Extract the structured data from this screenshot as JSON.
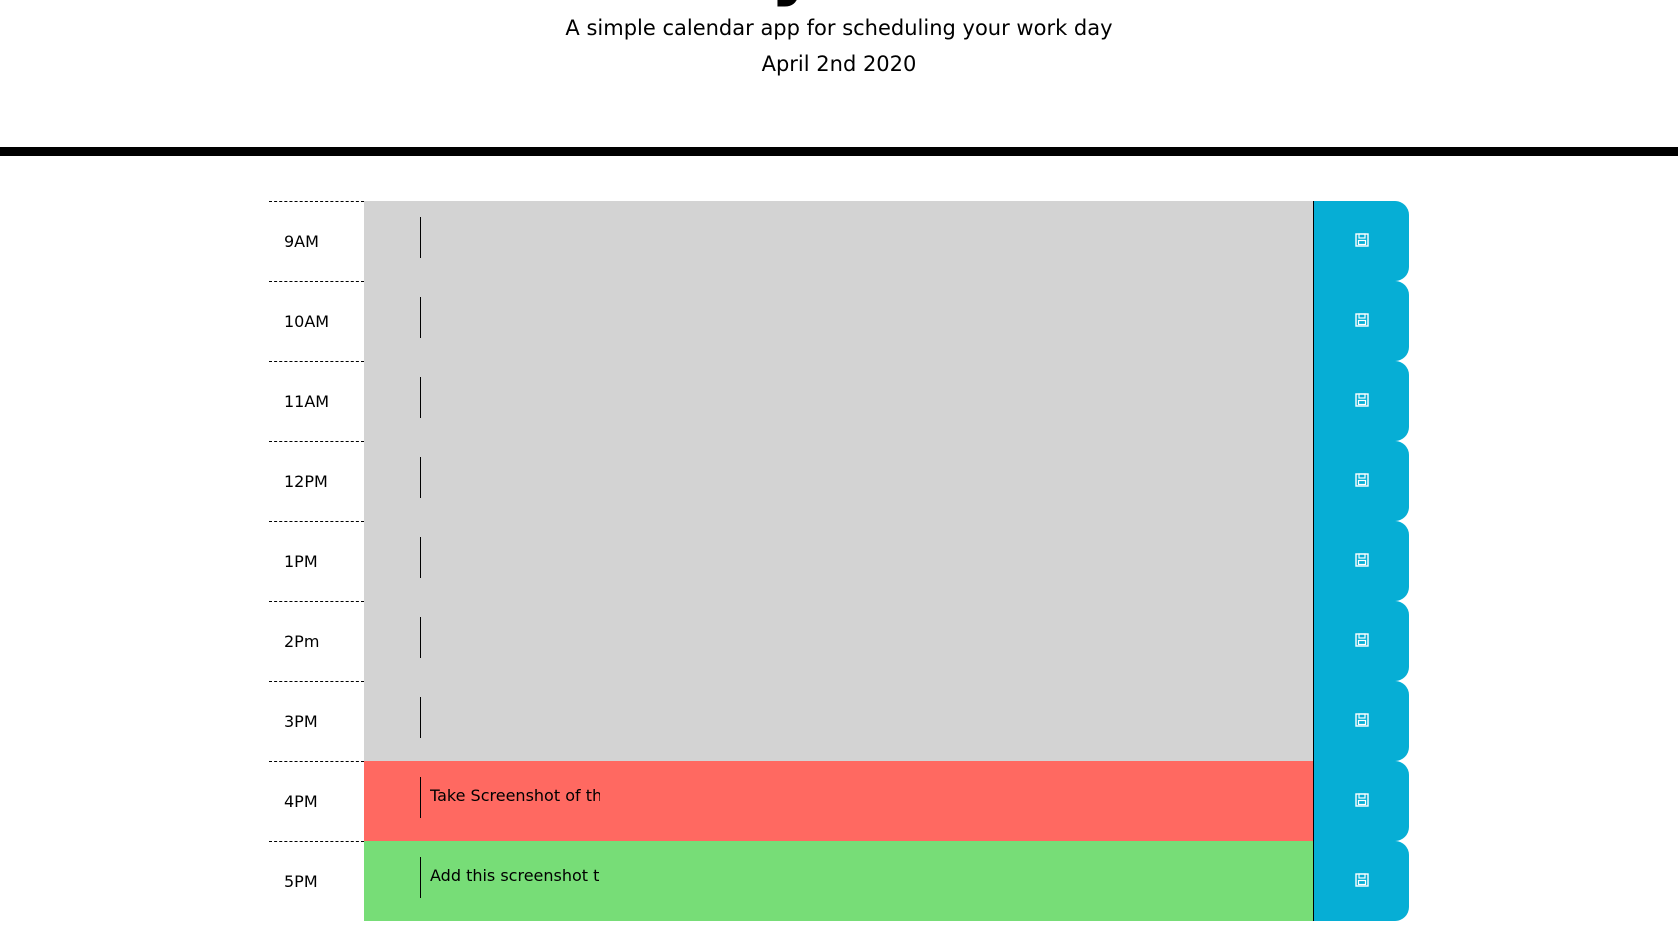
{
  "header": {
    "title": "Work Day Scheduler",
    "subtitle": "A simple calendar app for scheduling your work day",
    "date": "April 2nd 2020"
  },
  "rows": [
    {
      "hour": "9AM",
      "text": "",
      "status": "past"
    },
    {
      "hour": "10AM",
      "text": "",
      "status": "past"
    },
    {
      "hour": "11AM",
      "text": "",
      "status": "past"
    },
    {
      "hour": "12PM",
      "text": "",
      "status": "past"
    },
    {
      "hour": "1PM",
      "text": "",
      "status": "past"
    },
    {
      "hour": "2Pm",
      "text": "",
      "status": "past"
    },
    {
      "hour": "3PM",
      "text": "",
      "status": "past"
    },
    {
      "hour": "4PM",
      "text": "Take Screenshot of this",
      "status": "present"
    },
    {
      "hour": "5PM",
      "text": "Add this screenshot to",
      "status": "future"
    }
  ],
  "icons": {
    "save": "save-icon"
  },
  "colors": {
    "past": "#d3d3d3",
    "present": "#ff6961",
    "future": "#77dd77",
    "save": "#06aed5"
  }
}
